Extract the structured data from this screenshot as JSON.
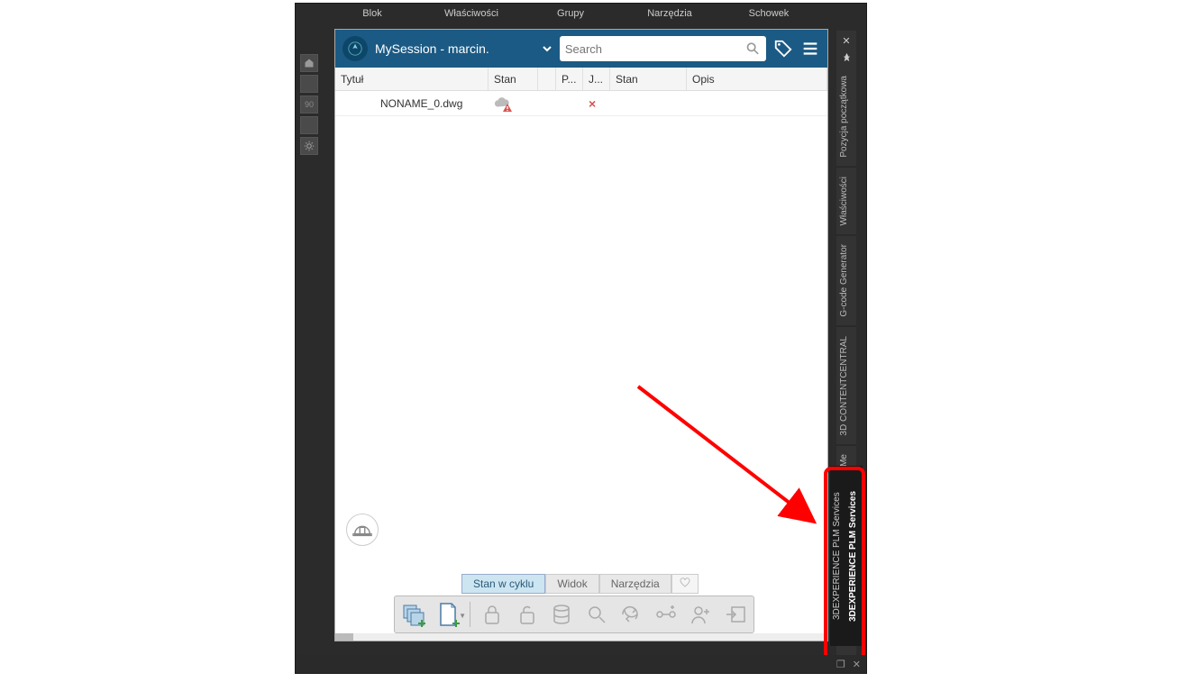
{
  "ribbon": {
    "tabs": [
      "Blok",
      "Właściwości",
      "Grupy",
      "Narzędzia",
      "Schowek"
    ]
  },
  "left_toolbar": {
    "home": "home-icon",
    "btn2": "",
    "ninety": "90",
    "btn4": "",
    "gear": "gear-icon"
  },
  "header": {
    "session": "MySession - marcin.",
    "search_placeholder": "Search"
  },
  "table": {
    "columns": {
      "tytul": "Tytuł",
      "stan": "Stan",
      "p": "P...",
      "j": "J...",
      "stan2": "Stan",
      "opis": "Opis"
    },
    "rows": [
      {
        "tytul": "NONAME_0.dwg",
        "stan": "warn",
        "j": "×"
      }
    ]
  },
  "bottom_tabs": {
    "t1": "Stan w cyklu",
    "t2": "Widok",
    "t3": "Narzędzia"
  },
  "side_tabs": {
    "t1": "Pozycja początkowa",
    "t2": "Właściwości",
    "t3": "G-code Generator",
    "t4": "3D CONTENTCENTRAL",
    "t5": "HomeByMe",
    "pair_a": "3DEXPERIENCE PLM Services",
    "pair_b": "3DEXPERIENCE PLM Services"
  }
}
